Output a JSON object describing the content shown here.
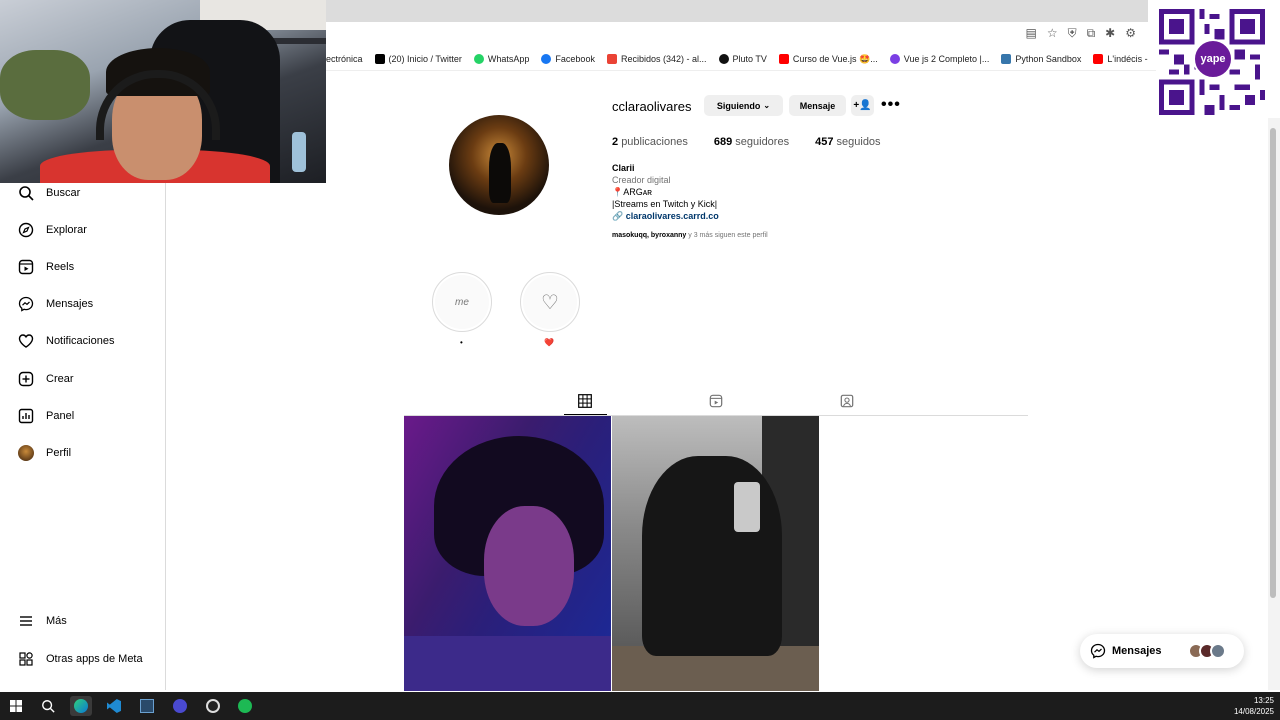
{
  "bookmarks": [
    {
      "label": "ectrónica",
      "color": "#ffffff"
    },
    {
      "label": "(20) Inicio / Twitter",
      "color": "#000000"
    },
    {
      "label": "WhatsApp",
      "color": "#25d366"
    },
    {
      "label": "Facebook",
      "color": "#1877f2"
    },
    {
      "label": "Recibidos (342) - al...",
      "color": "#ea4335"
    },
    {
      "label": "Pluto TV",
      "color": "#111111"
    },
    {
      "label": "Curso de Vue.js 🤩...",
      "color": "#ff0000"
    },
    {
      "label": "Vue js 2 Completo |...",
      "color": "#7b3fe4"
    },
    {
      "label": "Python Sandbox",
      "color": "#3776ab"
    },
    {
      "label": "L'indécis - Full Perfo...",
      "color": "#ff0000"
    }
  ],
  "qr": {
    "badge": "yape"
  },
  "sidebar": {
    "items": [
      {
        "label": "Buscar",
        "icon": "search-icon"
      },
      {
        "label": "Explorar",
        "icon": "compass-icon"
      },
      {
        "label": "Reels",
        "icon": "reels-icon"
      },
      {
        "label": "Mensajes",
        "icon": "messenger-icon"
      },
      {
        "label": "Notificaciones",
        "icon": "heart-icon"
      },
      {
        "label": "Crear",
        "icon": "plus-square-icon"
      },
      {
        "label": "Panel",
        "icon": "dashboard-icon"
      },
      {
        "label": "Perfil",
        "icon": "avatar"
      }
    ],
    "bottom": [
      {
        "label": "Más",
        "icon": "menu-icon"
      },
      {
        "label": "Otras apps de Meta",
        "icon": "meta-apps-icon"
      }
    ]
  },
  "profile": {
    "username": "cclaraolivares",
    "following_btn": "Siguiendo",
    "message_btn": "Mensaje",
    "more": "•••",
    "stats": {
      "posts_count": "2",
      "posts_label": "publicaciones",
      "followers_count": "689",
      "followers_label": "seguidores",
      "following_count": "457",
      "following_label": "seguidos"
    },
    "bio": {
      "name": "Clarii",
      "category": "Creador digital",
      "line1": "📍ARGᴀʀ",
      "line2": "|Streams en Twitch y Kick|",
      "link": "claraolivares.carrd.co"
    },
    "followed_by": {
      "names": "masokuqq, byroxanny",
      "suffix": "y 3 más siguen este perfil"
    }
  },
  "highlights": [
    {
      "label": "•",
      "cover_text": "me"
    },
    {
      "label": "❤️",
      "cover_text": "♡"
    }
  ],
  "messages_pill": {
    "label": "Mensajes"
  },
  "taskbar": {
    "time": "13:25",
    "date": "14/08/2025"
  }
}
